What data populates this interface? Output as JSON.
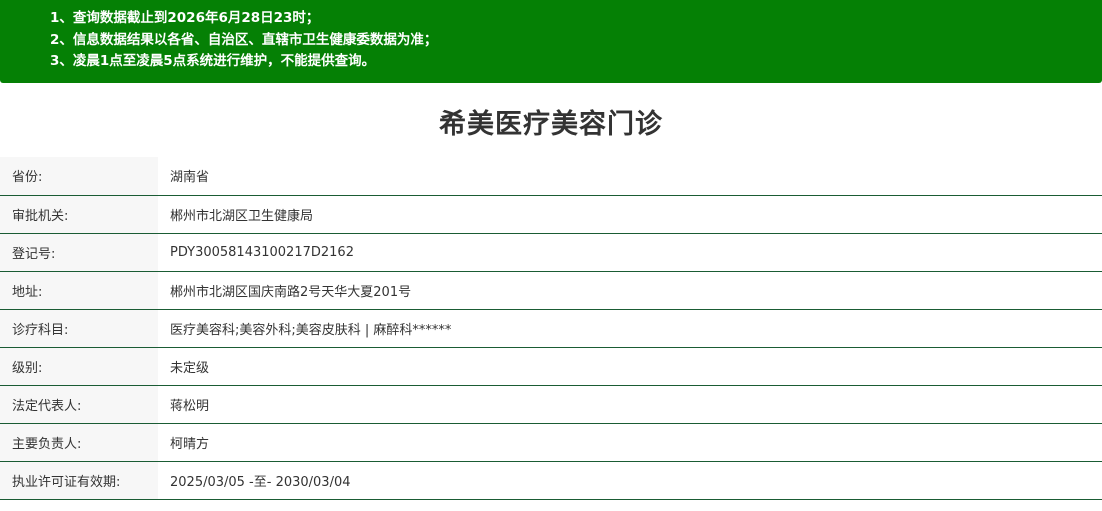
{
  "notice": {
    "lines": [
      "1、查询数据截止到2026年6月28日23时；",
      "2、信息数据结果以各省、自治区、直辖市卫生健康委数据为准；",
      "3、凌晨1点至凌晨5点系统进行维护，不能提供查询。"
    ]
  },
  "title": "希美医疗美容门诊",
  "rows": [
    {
      "label": "省份:",
      "value": "湖南省"
    },
    {
      "label": "审批机关:",
      "value": "郴州市北湖区卫生健康局"
    },
    {
      "label": "登记号:",
      "value": "PDY30058143100217D2162"
    },
    {
      "label": "地址:",
      "value": "郴州市北湖区国庆南路2号天华大夏201号"
    },
    {
      "label": "诊疗科目:",
      "value": "医疗美容科;美容外科;美容皮肤科 | 麻醉科******"
    },
    {
      "label": "级别:",
      "value": "未定级"
    },
    {
      "label": "法定代表人:",
      "value": "蒋松明"
    },
    {
      "label": "主要负责人:",
      "value": "柯晴方"
    },
    {
      "label": "执业许可证有效期:",
      "value": "2025/03/05 -至- 2030/03/04"
    }
  ],
  "colors": {
    "notice_bg": "#058005",
    "row_border": "#1a5c34",
    "label_bg": "#f7f7f7"
  }
}
